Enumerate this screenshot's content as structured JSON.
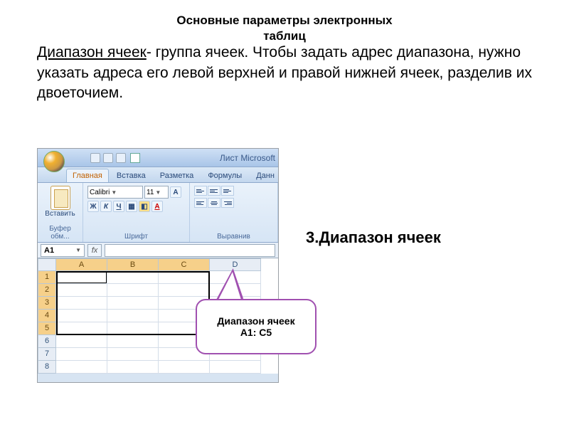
{
  "title_line1": "Основные параметры электронных",
  "title_line2": "таблиц",
  "body": {
    "term": "Диапазон ячеек",
    "rest": "- группа ячеек. Чтобы задать адрес диапазона, нужно указать адреса его левой верхней и правой нижней ячеек,  разделив их двоеточием."
  },
  "side_label_num": "3.",
  "side_label_text": "Диапазон ячеек",
  "callout_line1": "Диапазон ячеек",
  "callout_line2": "А1: С5",
  "excel": {
    "window_title": "Лист Microsoft",
    "tabs": {
      "home": "Главная",
      "insert": "Вставка",
      "layout": "Разметка",
      "formulas": "Формулы",
      "data": "Данн"
    },
    "clipboard": {
      "paste": "Вставить",
      "label": "Буфер обм..."
    },
    "font": {
      "name": "Calibri",
      "size": "11",
      "label": "Шрифт",
      "bold": "Ж",
      "italic": "К",
      "underline": "Ч"
    },
    "align_label": "Выравнив",
    "namebox": "A1",
    "fx": "fx",
    "cols": [
      "A",
      "B",
      "C",
      "D"
    ],
    "rows": [
      "1",
      "2",
      "3",
      "4",
      "5",
      "6",
      "7",
      "8"
    ]
  }
}
